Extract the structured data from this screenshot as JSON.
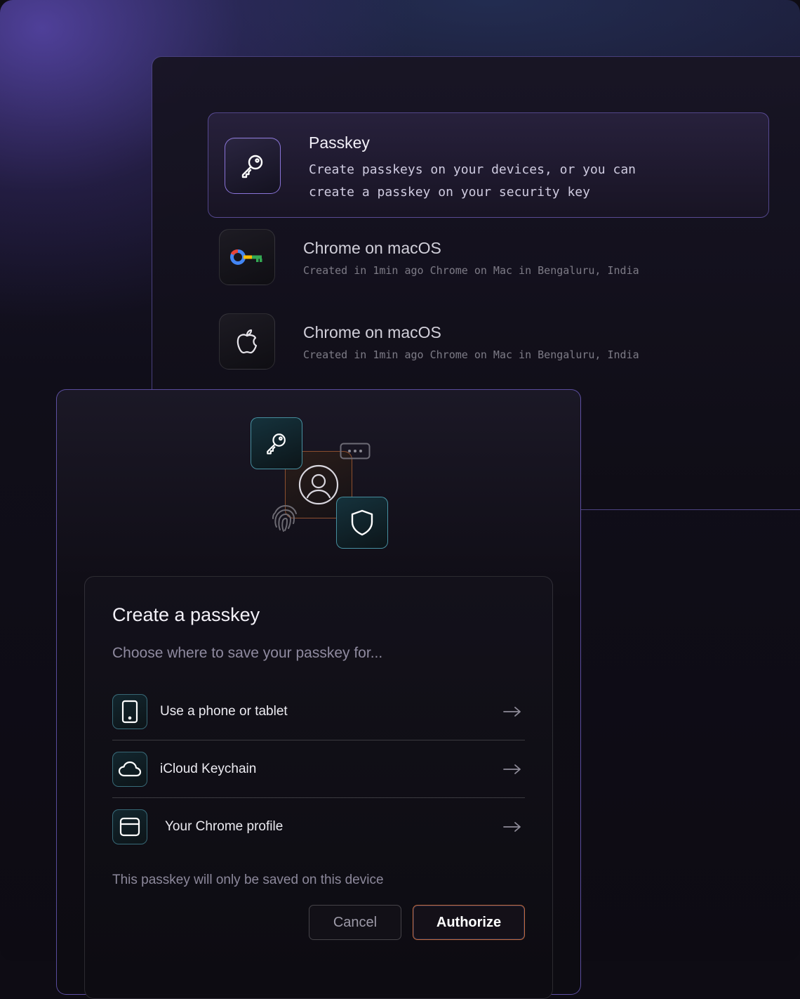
{
  "passkey_panel": {
    "title": "Passkey",
    "description": "Create passkeys on your devices, or you can\ncreate a passkey on your security key",
    "icon": "key-icon"
  },
  "devices": [
    {
      "title": "Chrome on macOS",
      "subtitle": "Created in 1min ago Chrome on Mac in Bengaluru, India",
      "icon": "google-password-manager-icon"
    },
    {
      "title": "Chrome on macOS",
      "subtitle": "Created in 1min ago Chrome on Mac in Bengaluru, India",
      "icon": "apple-icon"
    }
  ],
  "illustration": {
    "icons": [
      "key-icon",
      "user-icon",
      "shield-icon",
      "password-dots-icon",
      "fingerprint-icon"
    ]
  },
  "dialog": {
    "title": "Create a passkey",
    "subtitle": "Choose where to save your passkey for...",
    "options": [
      {
        "label": "Use a phone or tablet",
        "icon": "tablet-icon"
      },
      {
        "label": "iCloud Keychain",
        "icon": "cloud-icon"
      },
      {
        "label": "Your Chrome profile",
        "icon": "browser-window-icon"
      }
    ],
    "note": "This passkey will only be saved on this device",
    "cancel_label": "Cancel",
    "authorize_label": "Authorize"
  },
  "colors": {
    "accent_purple": "#8c78e6",
    "accent_teal": "#5ab4c8",
    "accent_orange": "#c66a3a",
    "background": "#0e0c14"
  }
}
